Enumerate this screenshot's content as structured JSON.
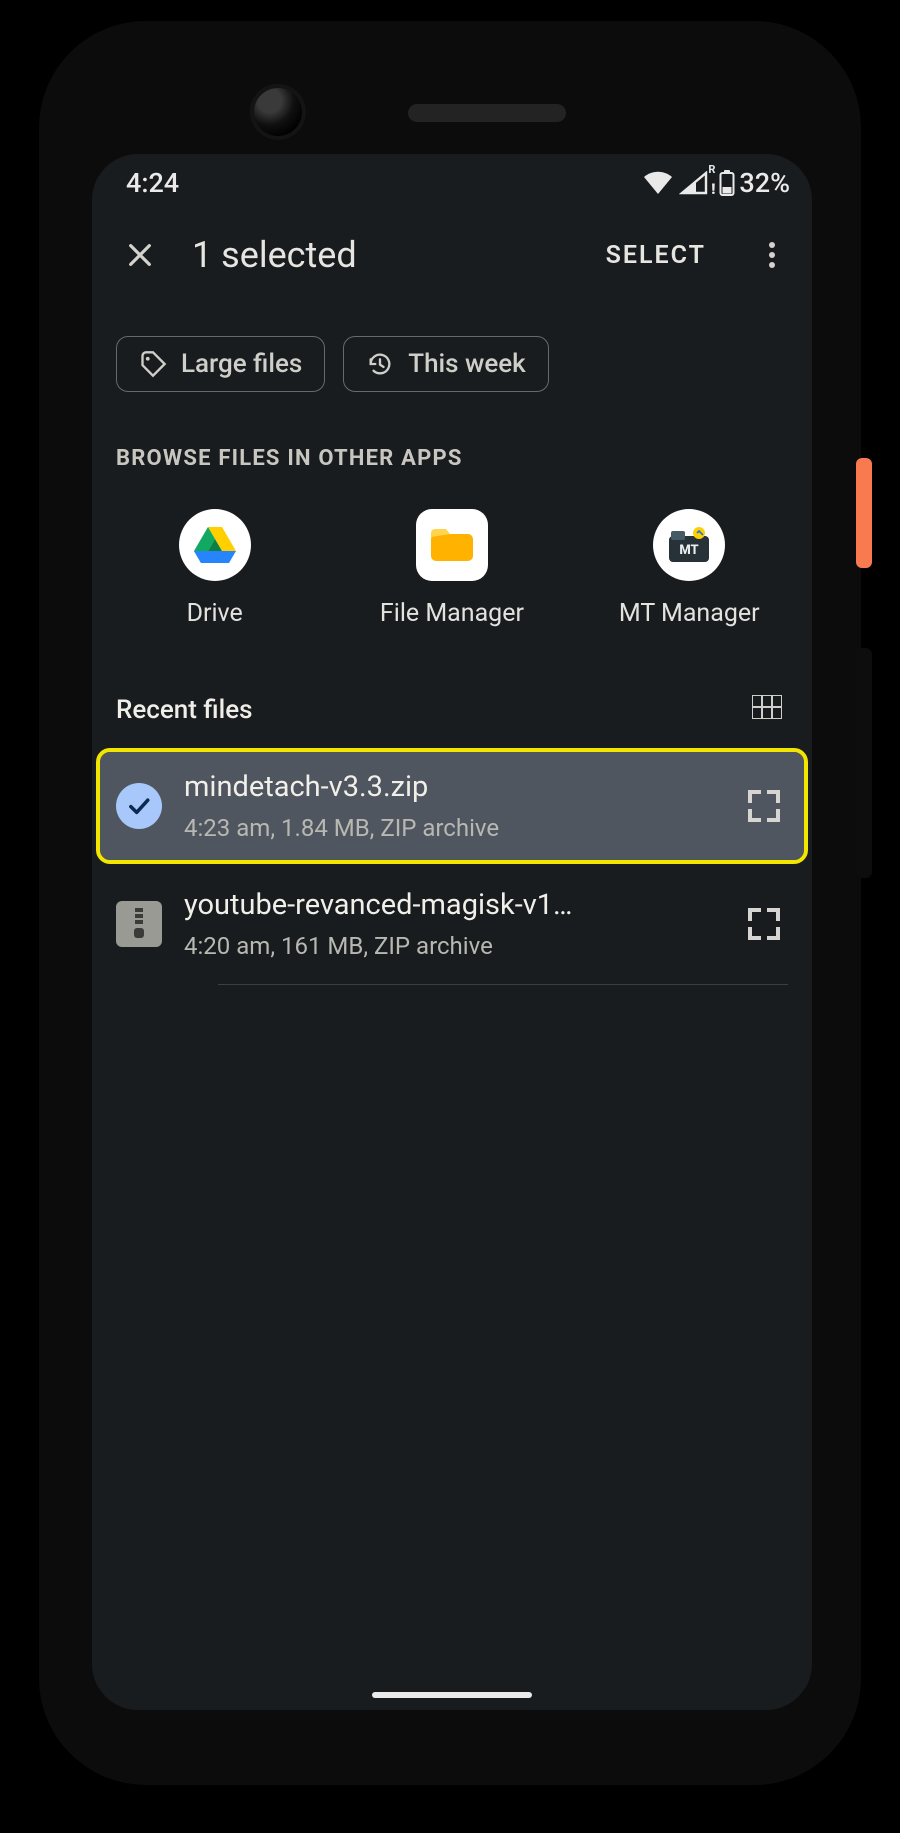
{
  "status": {
    "time": "4:24",
    "battery_pct": "32%",
    "network_roaming": "R"
  },
  "appbar": {
    "title": "1 selected",
    "select_btn": "SELECT"
  },
  "chips": {
    "large_files": "Large files",
    "this_week": "This week"
  },
  "browse": {
    "heading": "BROWSE FILES IN OTHER APPS",
    "apps": [
      {
        "label": "Drive",
        "icon": "drive"
      },
      {
        "label": "File Manager",
        "icon": "folder"
      },
      {
        "label": "MT Manager",
        "icon": "mtmanager"
      }
    ]
  },
  "recent": {
    "heading": "Recent files",
    "files": [
      {
        "name": "mindetach-v3.3.zip",
        "meta": "4:23 am, 1.84 MB, ZIP archive",
        "selected": true
      },
      {
        "name": "youtube-revanced-magisk-v1…",
        "meta": "4:20 am, 161 MB, ZIP archive",
        "selected": false
      }
    ]
  }
}
